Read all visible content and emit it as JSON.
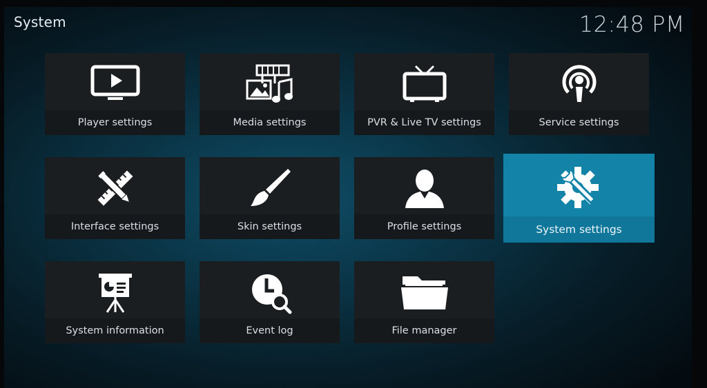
{
  "header": {
    "title": "System",
    "clock": "12:48 PM"
  },
  "tiles": [
    {
      "label": "Player settings",
      "icon": "monitor-play-icon"
    },
    {
      "label": "Media settings",
      "icon": "media-icon"
    },
    {
      "label": "PVR & Live TV settings",
      "icon": "tv-icon"
    },
    {
      "label": "Service settings",
      "icon": "podcast-icon"
    },
    {
      "label": "Interface settings",
      "icon": "pencil-ruler-icon"
    },
    {
      "label": "Skin settings",
      "icon": "paintbrush-icon"
    },
    {
      "label": "Profile settings",
      "icon": "user-icon"
    },
    {
      "label": "System settings",
      "icon": "gear-wrench-icon",
      "focused": true
    },
    {
      "label": "System information",
      "icon": "presentation-board-icon"
    },
    {
      "label": "Event log",
      "icon": "clock-search-icon"
    },
    {
      "label": "File manager",
      "icon": "folder-icon"
    }
  ],
  "colors": {
    "focus": "#1384a8",
    "tile": "#1b1e21",
    "background": "#0a3446"
  }
}
